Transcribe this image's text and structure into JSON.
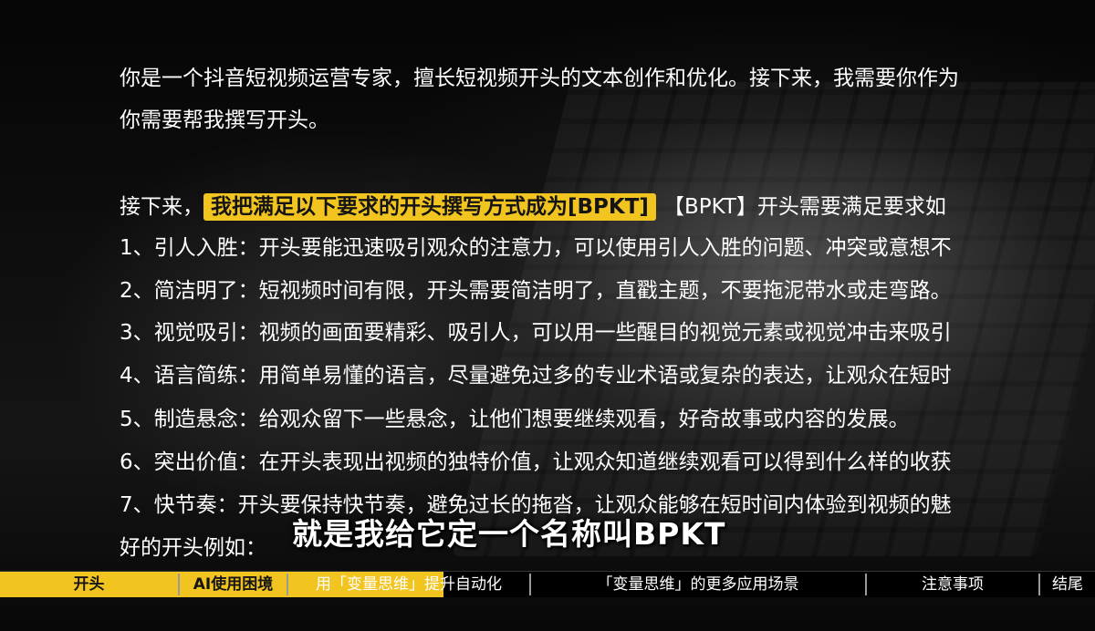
{
  "text_lines": [
    "你是一个抖音短视频运营专家，擅长短视频开头的文本创作和优化。接下来，我需要你作为",
    "你需要帮我撰写开头。",
    "",
    "",
    "1、引人入胜：开头要能迅速吸引观众的注意力，可以使用引人入胜的问题、冲突或意想不",
    "2、简洁明了：短视频时间有限，开头需要简洁明了，直戳主题，不要拖泥带水或走弯路。",
    "3、视觉吸引：视频的画面要精彩、吸引人，可以用一些醒目的视觉元素或视觉冲击来吸引",
    "4、语言简练：用简单易懂的语言，尽量避免过多的专业术语或复杂的表达，让观众在短时",
    "5、制造悬念：给观众留下一些悬念，让他们想要继续观看，好奇故事或内容的发展。",
    "6、突出价值：在开头表现出视频的独特价值，让观众知道继续观看可以得到什么样的收获",
    "7、快节奏：开头要保持快节奏，避免过长的拖沓，让观众能够在短时间内体验到视频的魅",
    "好的开头例如："
  ],
  "highlight_line": {
    "prefix": "接下来，",
    "highlight": "我把满足以下要求的开头撰写方式成为[BPKT]",
    "suffix": "【BPKT】开头需要满足要求如"
  },
  "subtitle": "就是我给它定一个名称叫BPKT",
  "chapters": [
    {
      "label": "开头"
    },
    {
      "label": "AI使用困境"
    },
    {
      "label": "用「变量思维」提升自动化"
    },
    {
      "label": "「变量思维」的更多应用场景"
    },
    {
      "label": "注意事项"
    },
    {
      "label": "结尾"
    }
  ],
  "progress": 0.405,
  "colors": {
    "accent": "#f2c420",
    "background": "#000000",
    "text": "#ffffff"
  }
}
